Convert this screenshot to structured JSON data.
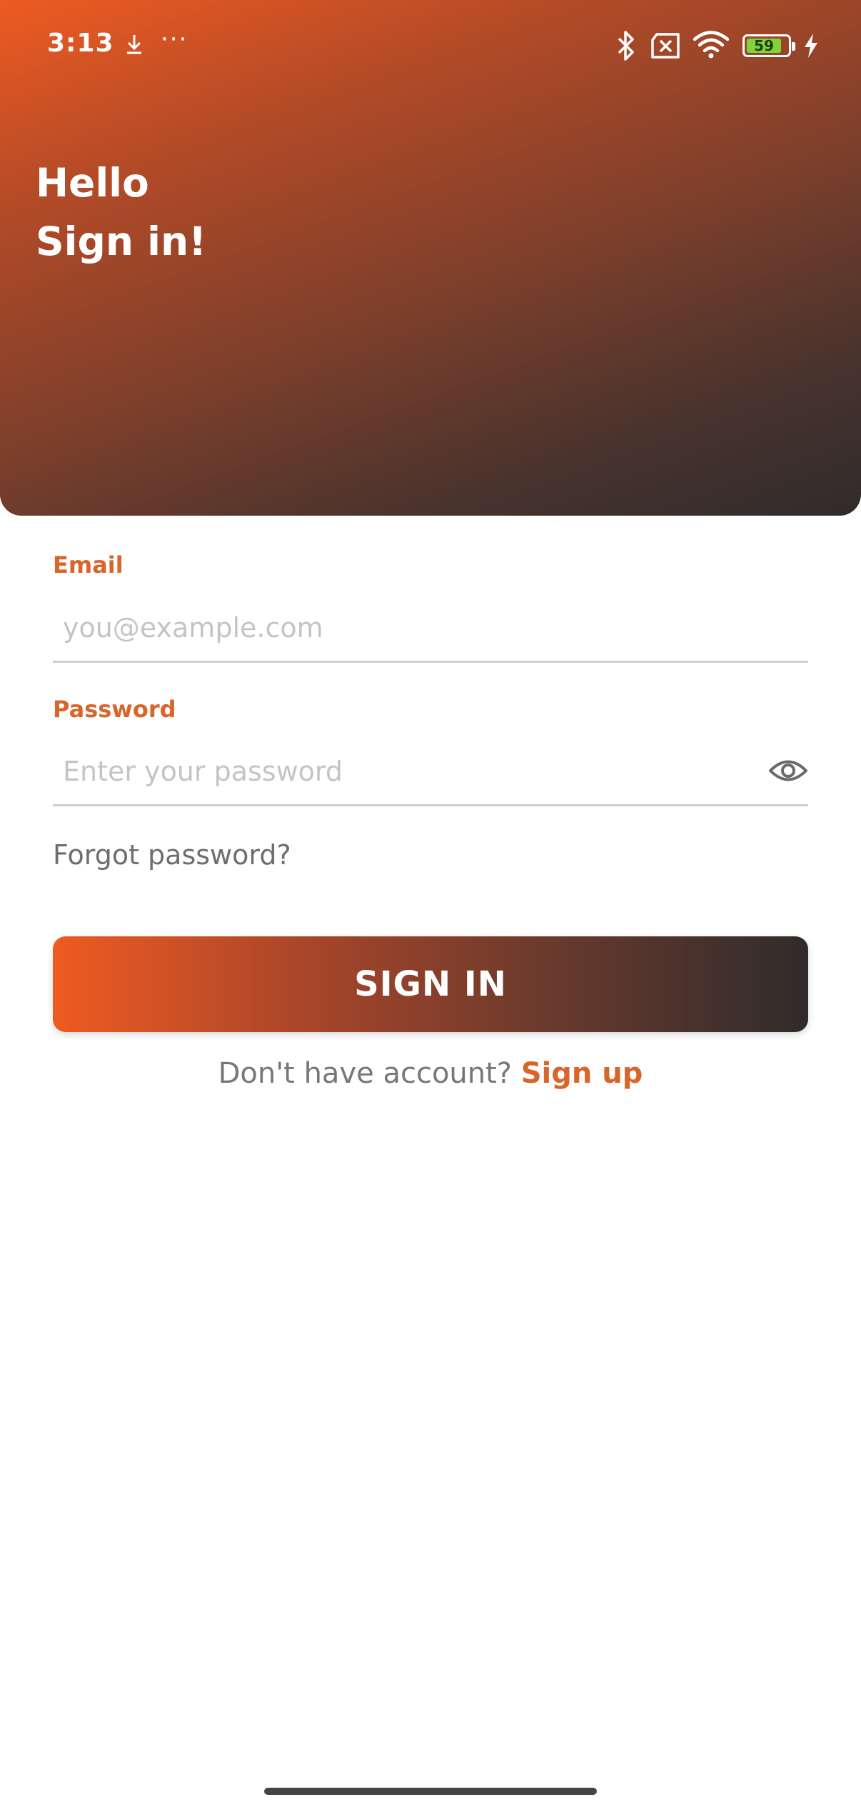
{
  "status_bar": {
    "time": "3:13",
    "more": "···",
    "battery_level": "59",
    "icons": [
      "download-icon",
      "bluetooth-icon",
      "sim-off-icon",
      "wifi-icon",
      "battery-icon",
      "charging-icon"
    ]
  },
  "header": {
    "greeting_line1": "Hello",
    "greeting_line2": "Sign in!"
  },
  "form": {
    "email_label": "Email",
    "email_placeholder": "you@example.com",
    "email_value": "",
    "password_label": "Password",
    "password_placeholder": "Enter your password",
    "password_value": "",
    "forgot_label": "Forgot password?",
    "submit_label": "SIGN IN"
  },
  "footer": {
    "signup_prompt": "Don't have account?",
    "signup_link": "Sign up"
  },
  "colors": {
    "accent": "#d9652a",
    "gradient_start": "#ee5b22",
    "gradient_end": "#2f2c2b"
  }
}
